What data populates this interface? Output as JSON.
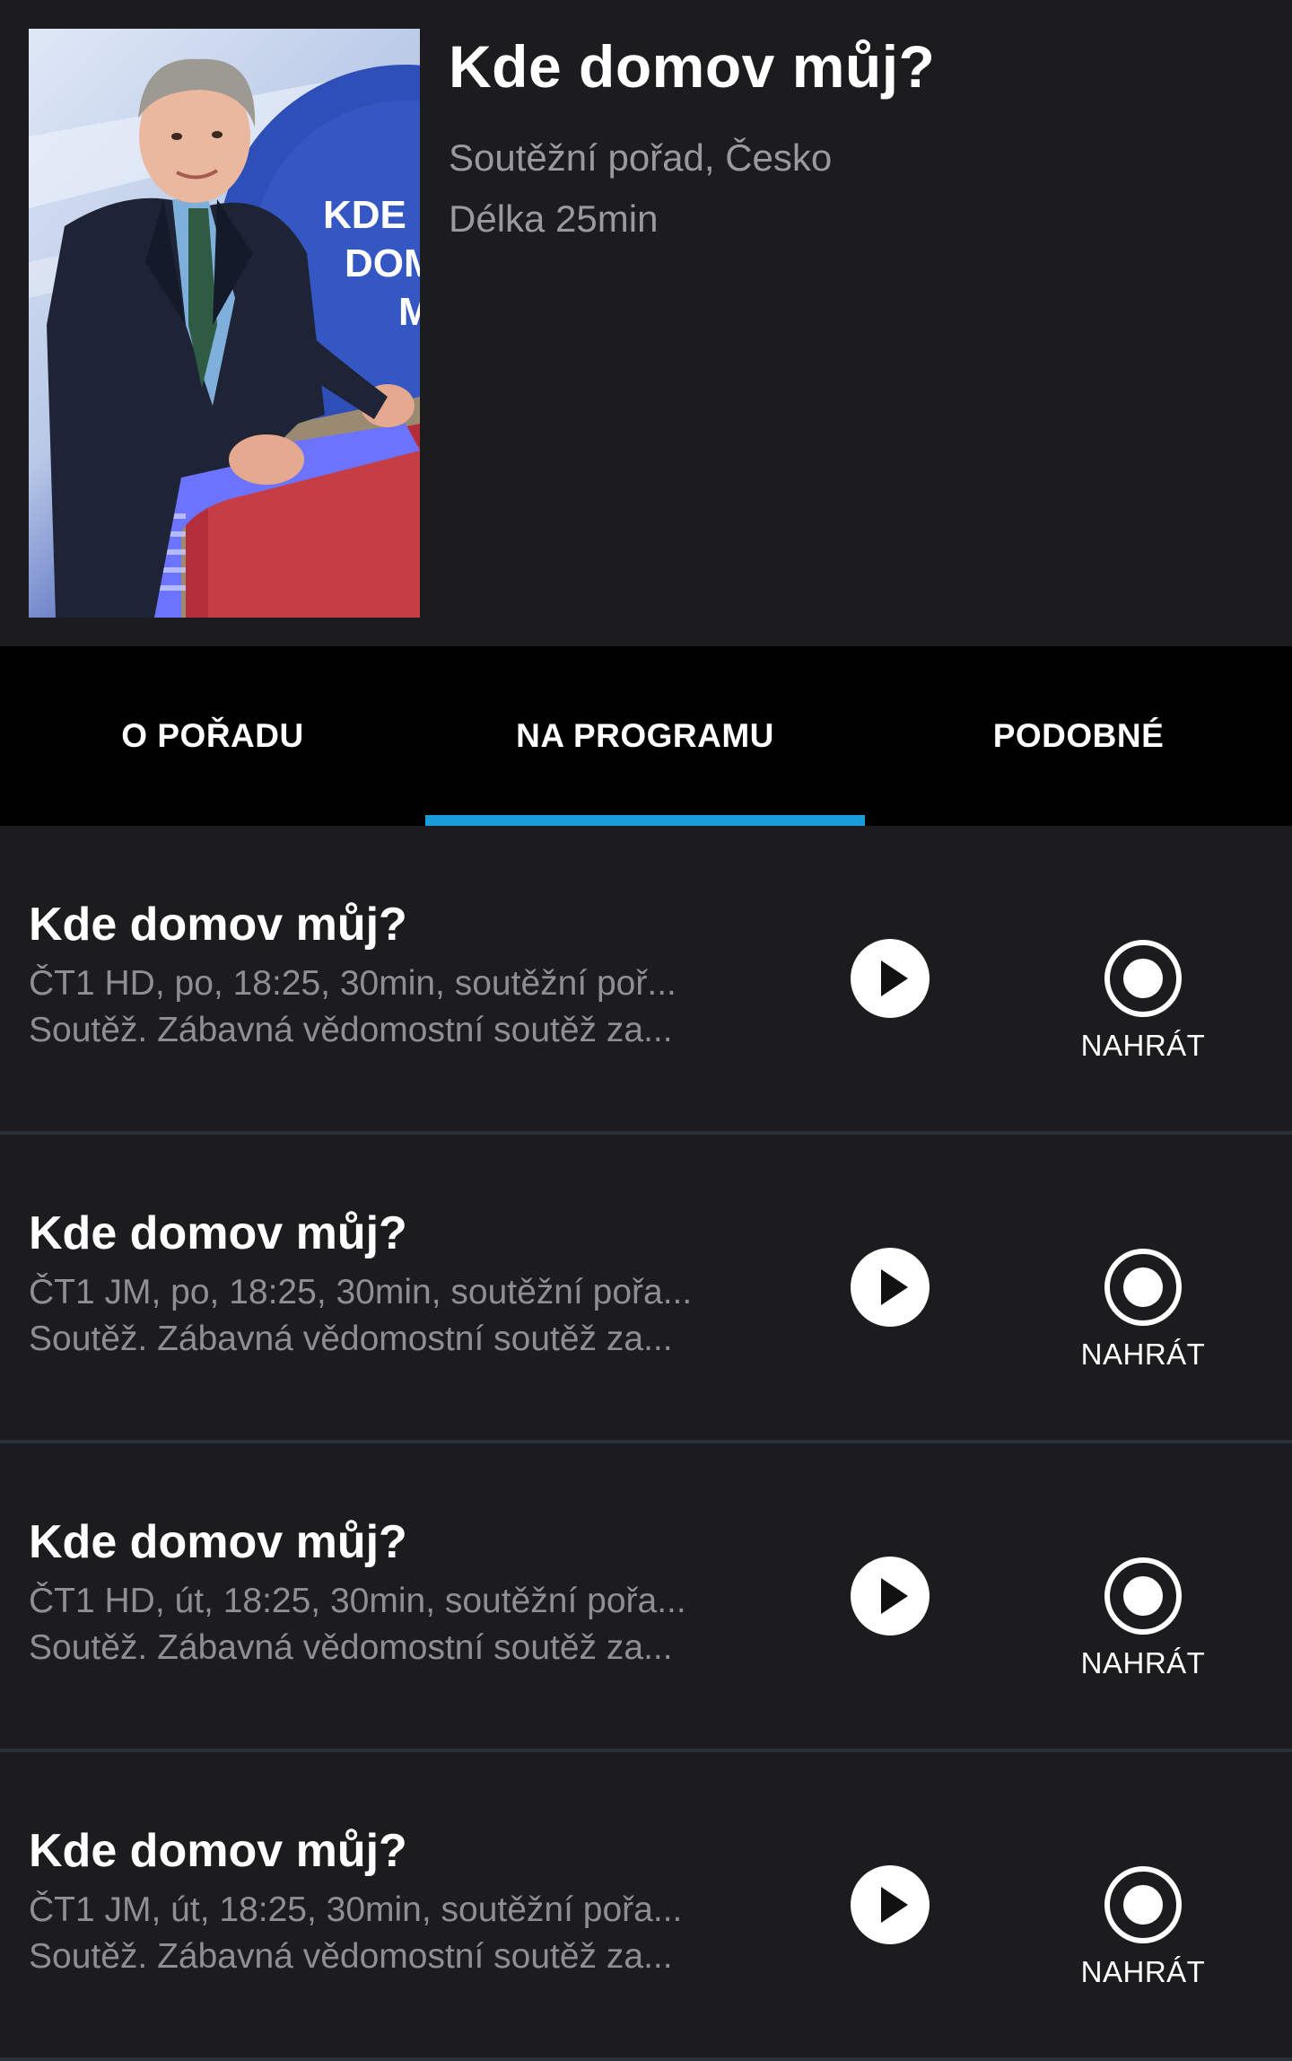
{
  "show": {
    "title": "Kde domov můj?",
    "genre": "Soutěžní pořad, Česko",
    "duration": "Délka 25min",
    "poster_text": [
      "KDE",
      "DOM",
      "M"
    ]
  },
  "tabs": [
    {
      "label": "O POŘADU",
      "active": false
    },
    {
      "label": "NA PROGRAMU",
      "active": true
    },
    {
      "label": "PODOBNÉ",
      "active": false
    }
  ],
  "colors": {
    "accent": "#1a9cdb",
    "background": "#1c1c1e",
    "tab_bar": "#000000",
    "secondary_text": "#8e8e93"
  },
  "icons": {
    "play": "play-icon",
    "record": "record-icon"
  },
  "items": [
    {
      "title": "Kde domov můj?",
      "details": "ČT1 HD, po, 18:25, 30min, soutěžní poř...",
      "description": "Soutěž. Zábavná vědomostní soutěž za...",
      "record_label": "NAHRÁT"
    },
    {
      "title": "Kde domov můj?",
      "details": "ČT1 JM, po, 18:25, 30min, soutěžní pořa...",
      "description": "Soutěž. Zábavná vědomostní soutěž za...",
      "record_label": "NAHRÁT"
    },
    {
      "title": "Kde domov můj?",
      "details": "ČT1 HD, út, 18:25, 30min, soutěžní pořa...",
      "description": "Soutěž. Zábavná vědomostní soutěž za...",
      "record_label": "NAHRÁT"
    },
    {
      "title": "Kde domov můj?",
      "details": "ČT1 JM, út, 18:25, 30min, soutěžní pořa...",
      "description": "Soutěž. Zábavná vědomostní soutěž za...",
      "record_label": "NAHRÁT"
    }
  ]
}
